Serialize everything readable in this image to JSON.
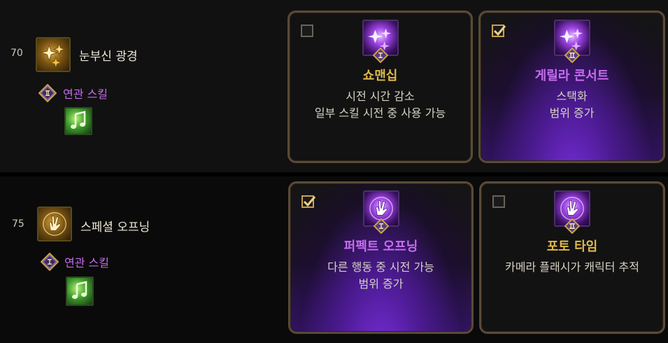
{
  "skills": [
    {
      "level": "70",
      "name": "눈부신 광경",
      "related_label": "연관 스킬",
      "options": [
        {
          "title": "쇼맨십",
          "desc": [
            "시전 시간 감소",
            "일부 스킬 시전 중 사용 가능"
          ],
          "tier": "I",
          "checked": false
        },
        {
          "title": "게릴라 콘서트",
          "desc": [
            "스택화",
            "범위 증가"
          ],
          "tier": "II",
          "checked": true
        }
      ]
    },
    {
      "level": "75",
      "name": "스페셜 오프닝",
      "related_label": "연관 스킬",
      "options": [
        {
          "title": "퍼펙트 오프닝",
          "desc": [
            "다른 행동 중 시전 가능",
            "범위 증가"
          ],
          "tier": "I",
          "checked": true
        },
        {
          "title": "포토 타임",
          "desc": [
            "카메라 플래시가 캐릭터 추적"
          ],
          "tier": "II",
          "checked": false
        }
      ]
    }
  ],
  "colors": {
    "gold_title": "#e0b94a",
    "purple_title": "#c86cf0",
    "related_label": "#c86cf0",
    "card_border": "#5a4a36"
  },
  "icons": {
    "skill_icon": "gold-skill-icon",
    "related_icon": "green-music-note-icon",
    "tier_badge": "diamond-roman-numeral-icon",
    "checkbox": "checkmark-icon"
  }
}
